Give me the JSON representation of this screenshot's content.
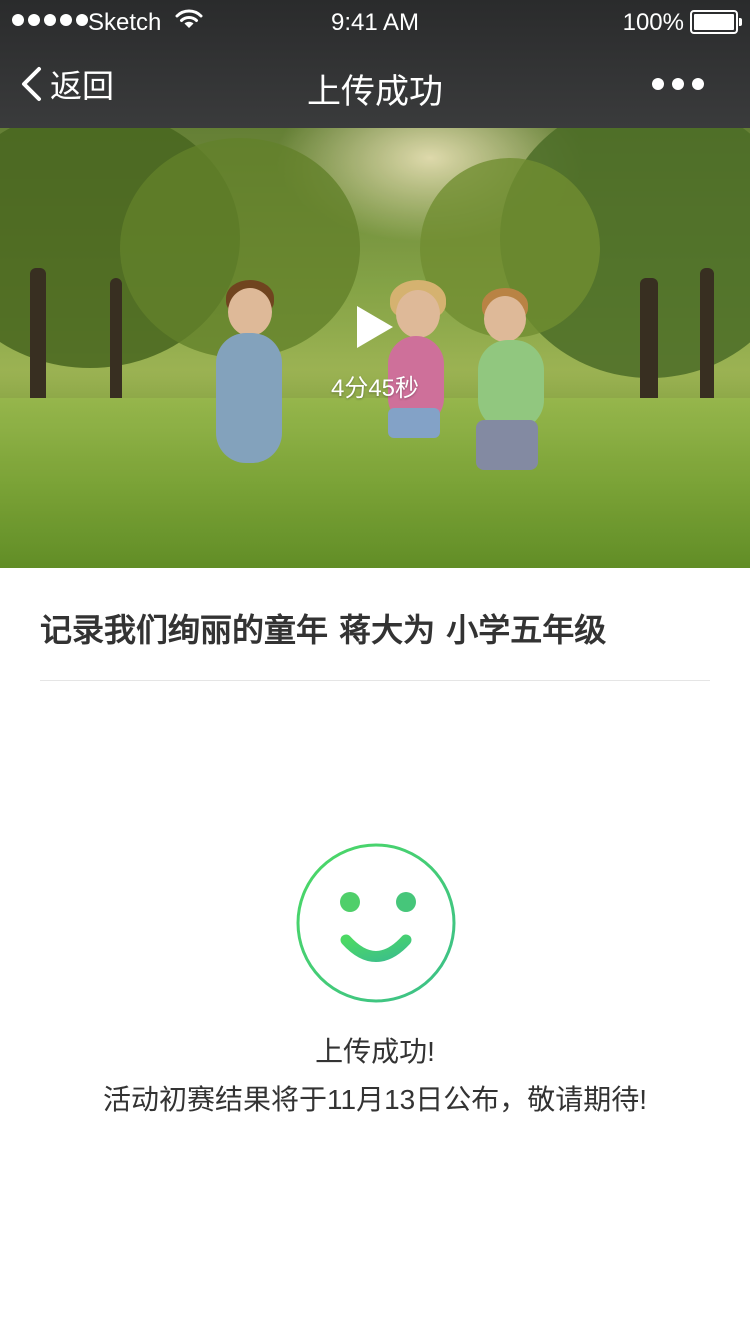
{
  "status_bar": {
    "carrier": "Sketch",
    "time": "9:41 AM",
    "battery": "100%"
  },
  "nav": {
    "back_label": "返回",
    "title": "上传成功"
  },
  "video": {
    "duration": "4分45秒"
  },
  "entry": {
    "title": "记录我们绚丽的童年 蒋大为 小学五年级"
  },
  "result": {
    "message": "上传成功!",
    "detail": "活动初赛结果将于11月13日公布，敬请期待!"
  },
  "colors": {
    "accent_start": "#4cd964",
    "accent_end": "#3cbf8a",
    "nav_bg": "#333333"
  },
  "icons": {
    "back": "chevron-left-icon",
    "more": "more-dots-icon",
    "play": "play-icon",
    "success": "smiley-icon"
  }
}
